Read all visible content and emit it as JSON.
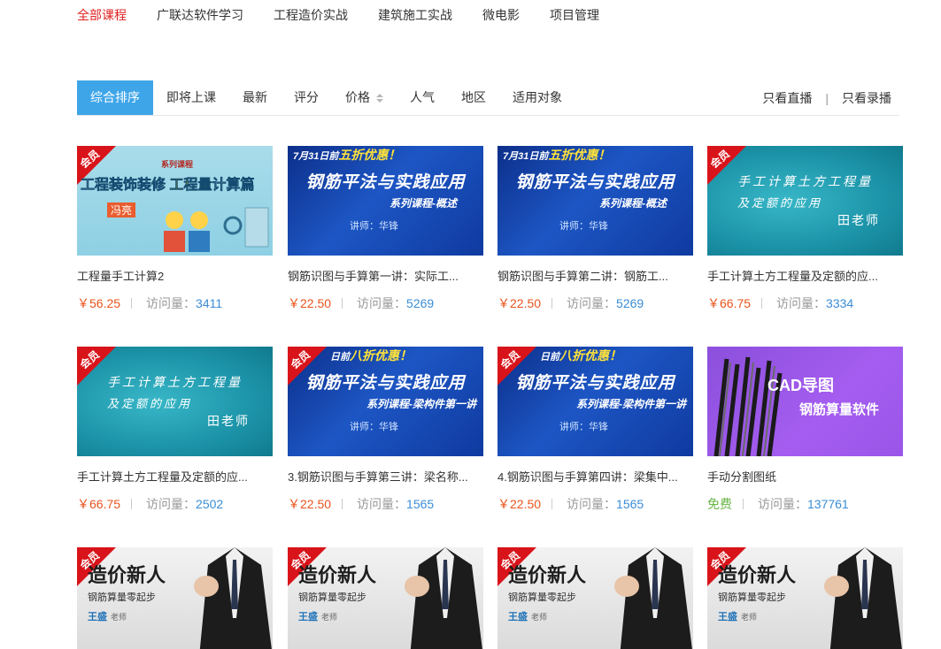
{
  "topnav": [
    {
      "label": "全部课程",
      "active": true
    },
    {
      "label": "广联达软件学习",
      "active": false
    },
    {
      "label": "工程造价实战",
      "active": false
    },
    {
      "label": "建筑施工实战",
      "active": false
    },
    {
      "label": "微电影",
      "active": false
    },
    {
      "label": "项目管理",
      "active": false
    }
  ],
  "sortbar": {
    "items": [
      "综合排序",
      "即将上课",
      "最新",
      "评分",
      "价格",
      "人气",
      "地区",
      "适用对象"
    ],
    "filter_live": "只看直播",
    "filter_separator": "|",
    "filter_recorded": "只看录播"
  },
  "visits_label": "访问量：",
  "thumb_text": {
    "badge": "会员",
    "light_top": "系列课程",
    "light_title_a": "工程装饰装修",
    "light_title_b": "工程量",
    "light_title_c": "计算篇",
    "light_name": "冯亮",
    "promo_a_prefix": "7月31日前",
    "promo_a_bold": "五折优惠！",
    "promo_b_prefix": "日前",
    "promo_b_bold": "八折优惠！",
    "blue_title": "钢筋平法与实践应用",
    "blue_sub_a": "系列课程-概述",
    "blue_sub_b": "系列课程-梁构件第一讲",
    "blue_teacher": "讲师：华锋",
    "teal_l1": "手工计算土方工程量",
    "teal_l2": "及定额的应用",
    "teal_t": "田老师",
    "cad_title": "CAD导图",
    "cad_sub": "钢筋算量软件",
    "grey_title": "造价新人",
    "grey_sub": "钢筋算量零起步",
    "grey_name": "王盛",
    "grey_role": "老师"
  },
  "courses": [
    {
      "title": "工程量手工计算2",
      "price": "￥56.25",
      "visits": "3411"
    },
    {
      "title": "钢筋识图与手算第一讲：实际工...",
      "price": "￥22.50",
      "visits": "5269"
    },
    {
      "title": "钢筋识图与手算第二讲：钢筋工...",
      "price": "￥22.50",
      "visits": "5269"
    },
    {
      "title": "手工计算土方工程量及定额的应...",
      "price": "￥66.75",
      "visits": "3334"
    },
    {
      "title": "手工计算土方工程量及定额的应...",
      "price": "￥66.75",
      "visits": "2502"
    },
    {
      "title": "3.钢筋识图与手算第三讲：梁名称...",
      "price": "￥22.50",
      "visits": "1565"
    },
    {
      "title": "4.钢筋识图与手算第四讲：梁集中...",
      "price": "￥22.50",
      "visits": "1565"
    },
    {
      "title": "手动分割图纸",
      "price": "免费",
      "visits": "137761"
    }
  ]
}
